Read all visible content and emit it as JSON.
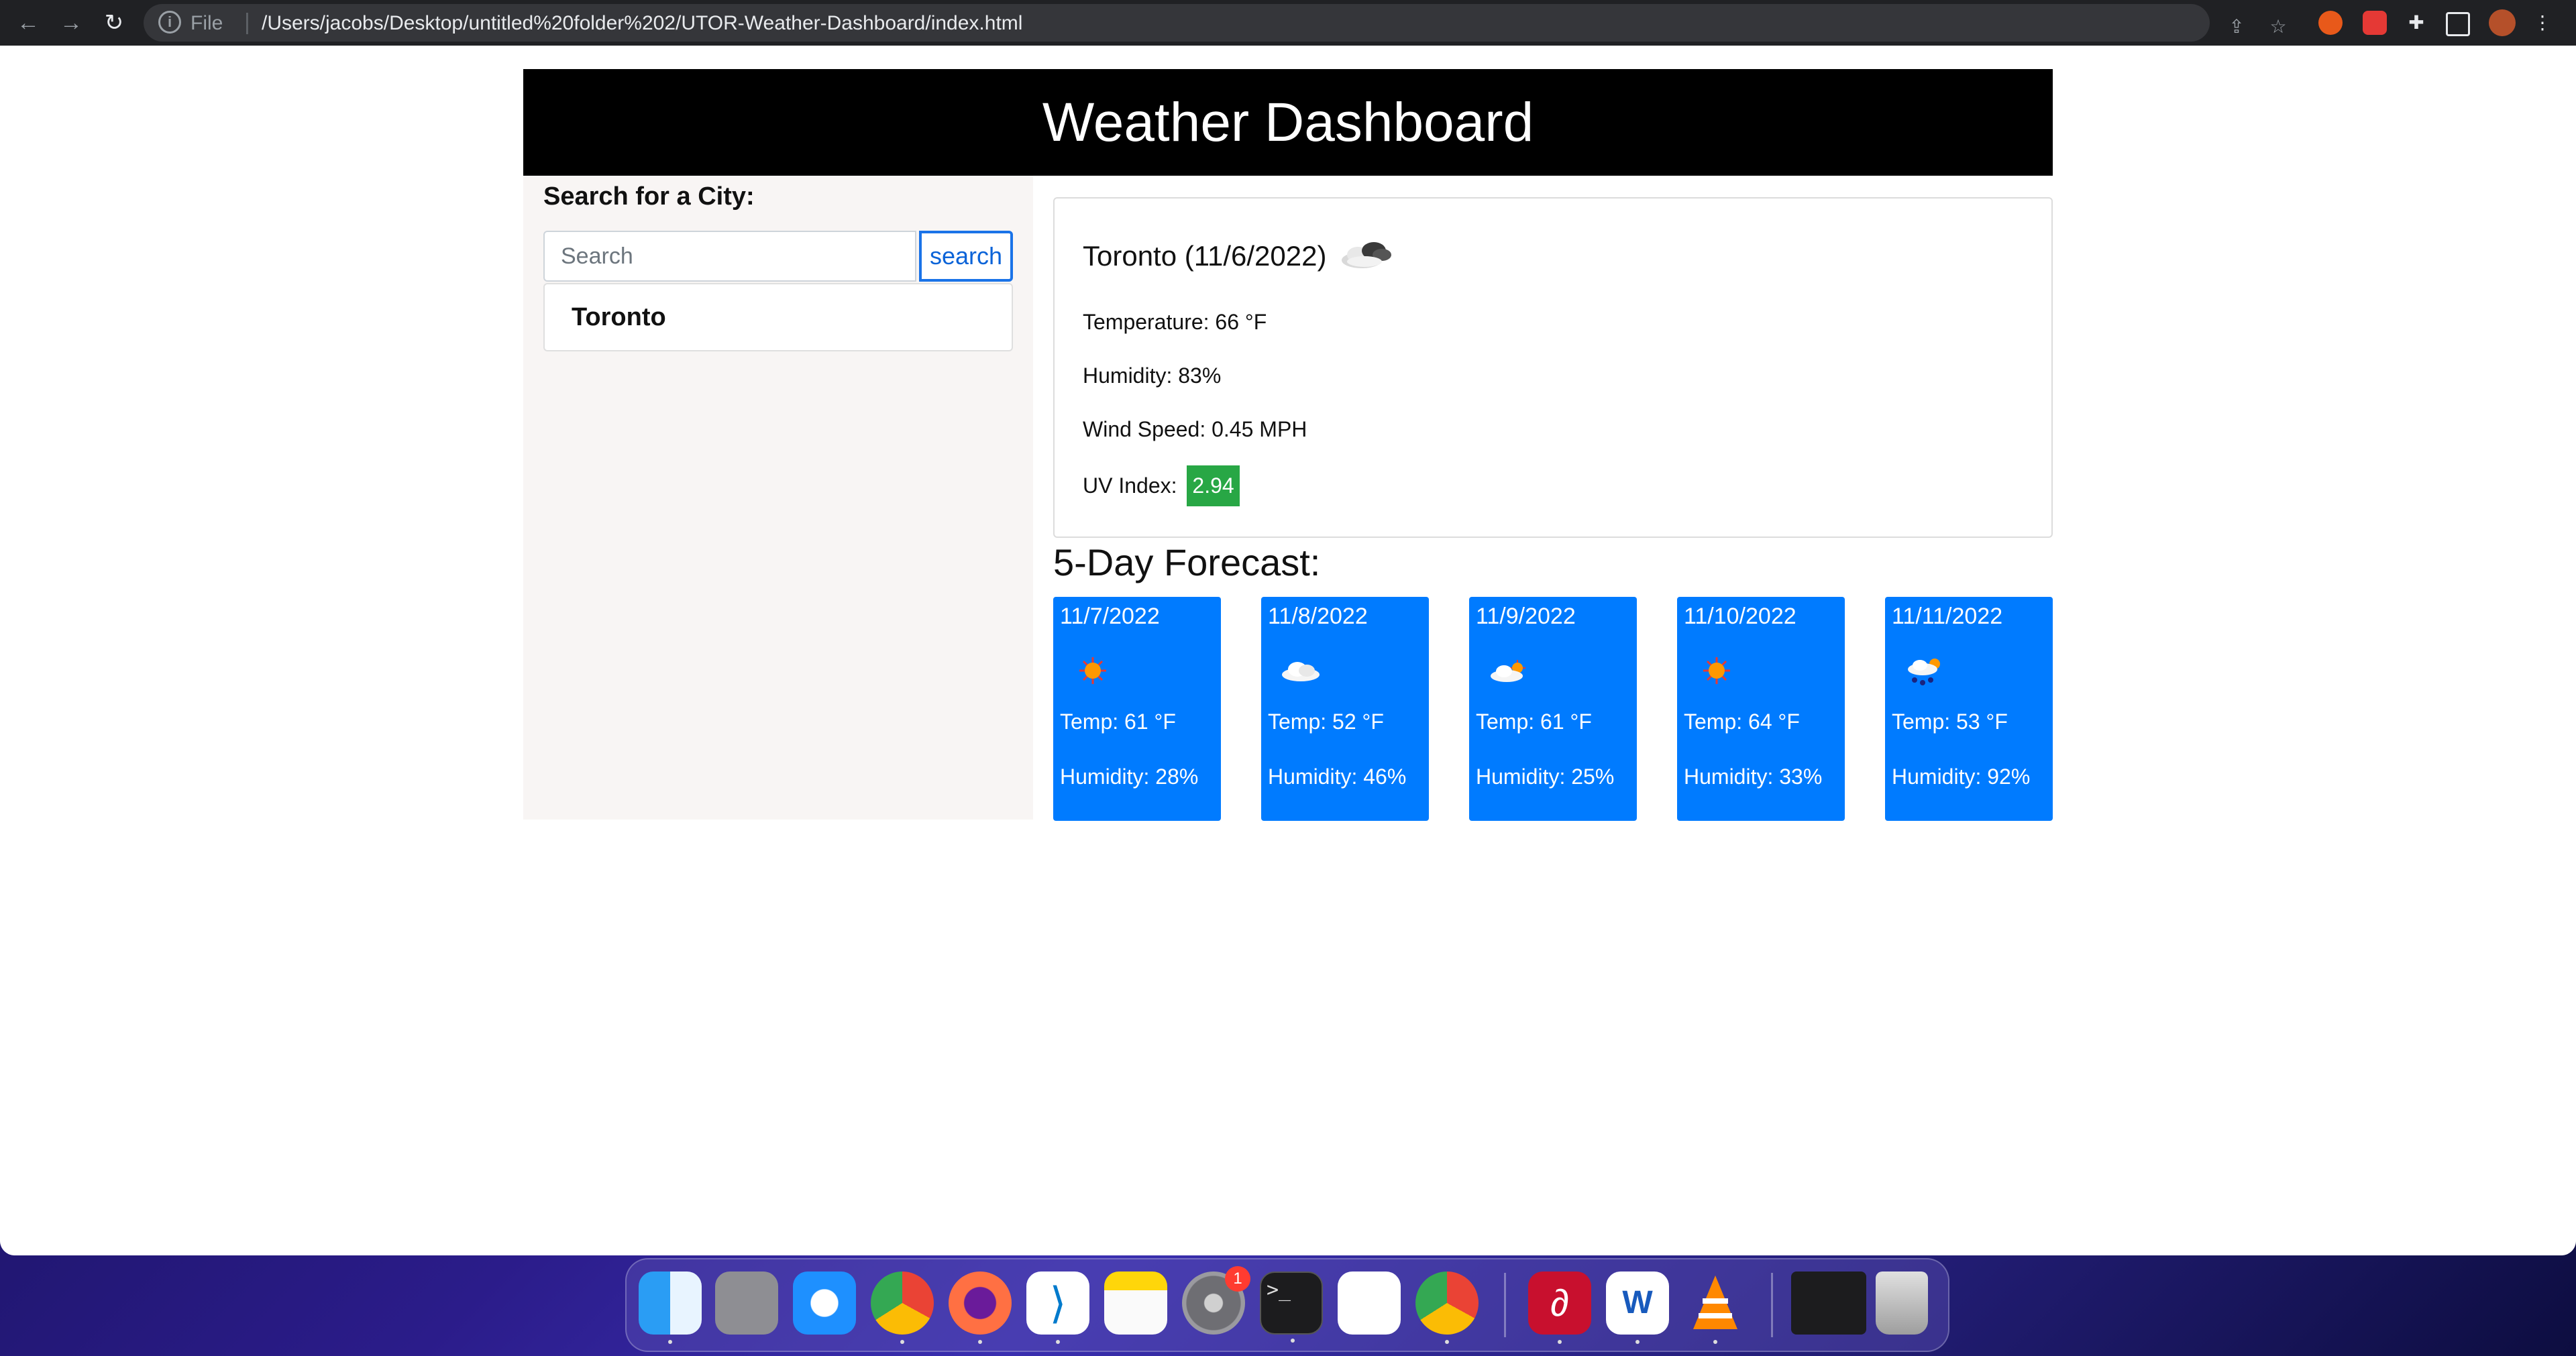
{
  "browser": {
    "omnibox_scheme": "File",
    "url": "/Users/jacobs/Desktop/untitled%20folder%202/UTOR-Weather-Dashboard/index.html"
  },
  "page": {
    "title": "Weather Dashboard",
    "search": {
      "heading": "Search for a City:",
      "placeholder": "Search",
      "button_label": "search"
    },
    "history": [
      "Toronto"
    ],
    "current": {
      "title": "Toronto (11/6/2022)",
      "icon": "cloudy-icon",
      "temperature": "Temperature: 66 °F",
      "humidity": "Humidity: 83%",
      "wind": "Wind Speed: 0.45 MPH",
      "uv_label": "UV Index:",
      "uv_value": "2.94",
      "uv_color": "#28a745"
    },
    "forecast_title": "5-Day Forecast:",
    "forecast": [
      {
        "date": "11/7/2022",
        "icon": "sun-icon",
        "temp": "Temp: 61 °F",
        "humidity": "Humidity: 28%"
      },
      {
        "date": "11/8/2022",
        "icon": "cloud-icon",
        "temp": "Temp: 52 °F",
        "humidity": "Humidity: 46%"
      },
      {
        "date": "11/9/2022",
        "icon": "partly-cloudy-icon",
        "temp": "Temp: 61 °F",
        "humidity": "Humidity: 25%"
      },
      {
        "date": "11/10/2022",
        "icon": "sun-icon",
        "temp": "Temp: 64 °F",
        "humidity": "Humidity: 33%"
      },
      {
        "date": "11/11/2022",
        "icon": "rain-icon",
        "temp": "Temp: 53 °F",
        "humidity": "Humidity: 92%"
      }
    ],
    "card_color": "#007bff"
  },
  "dock": {
    "apps": [
      "finder-icon",
      "launchpad-icon",
      "safari-icon",
      "chrome-icon",
      "firefox-icon",
      "vscode-icon",
      "notes-icon",
      "system-preferences-icon",
      "terminal-icon",
      "slack-icon",
      "chrome-canary-icon",
      "acrobat-icon",
      "word-icon",
      "vlc-icon",
      "minimized-window-icon",
      "trash-icon"
    ],
    "system_preferences_badge": "1"
  }
}
